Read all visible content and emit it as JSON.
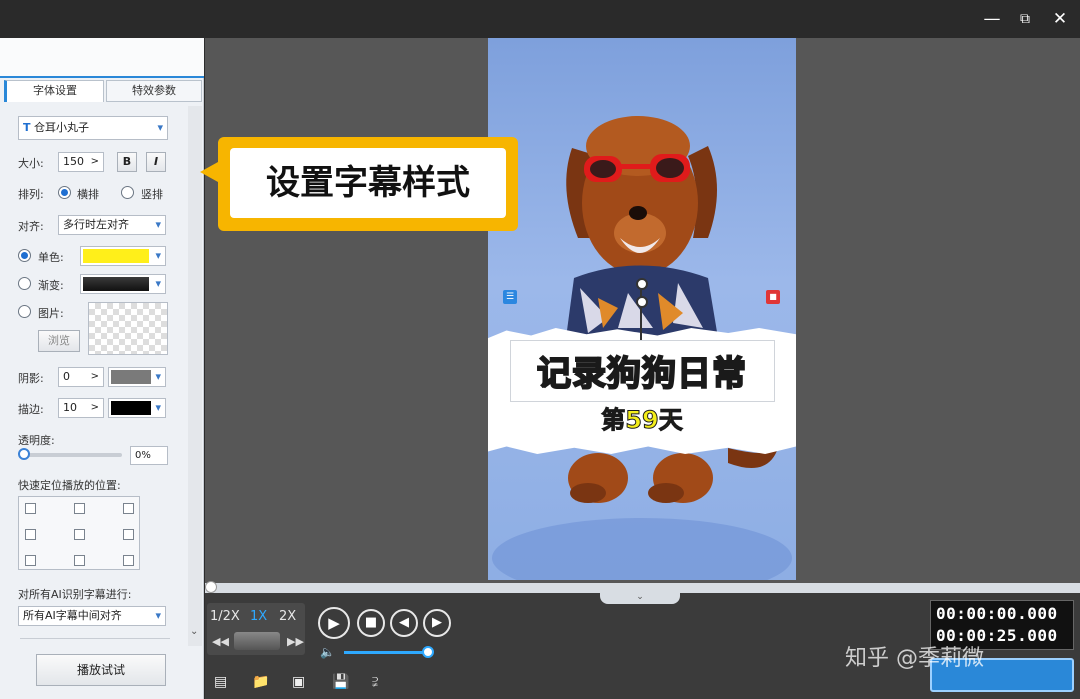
{
  "window": {
    "minimize_icon": "minimize-icon",
    "restore_icon": "restore-icon",
    "close_icon": "close-icon"
  },
  "tabs": [
    "字体设置",
    "特效参数"
  ],
  "font": {
    "name_prefix": "T",
    "name": "仓耳小丸子"
  },
  "size": {
    "label": "大小:",
    "value": "150",
    "bold": "B",
    "italic": "I"
  },
  "arrange": {
    "label": "排列:",
    "horizontal": "横排",
    "vertical": "竖排"
  },
  "align": {
    "label": "对齐:",
    "value": "多行时左对齐"
  },
  "color": {
    "solid_label": "单色:",
    "solid_value": "#ffef1a",
    "gradient_label": "渐变:",
    "image_label": "图片:",
    "browse": "浏览"
  },
  "shadow": {
    "label": "阴影:",
    "value": "0",
    "color": "#7a7a7a"
  },
  "stroke": {
    "label": "描边:",
    "value": "10",
    "color": "#000000"
  },
  "opacity": {
    "label": "透明度:",
    "value": "0%"
  },
  "position": {
    "label": "快速定位播放的位置:"
  },
  "ai": {
    "label": "对所有AI识别字幕进行:",
    "value": "所有AI字幕中间对齐"
  },
  "play_test": "播放试试",
  "callout": "设置字幕样式",
  "caption": {
    "title": "记录狗狗日常",
    "subtitle": "第59天"
  },
  "speeds": [
    "1/2X",
    "1X",
    "2X"
  ],
  "time": {
    "current": "00:00:00.000",
    "total": "00:00:25.000"
  },
  "watermark": "知乎 @季莉微",
  "colors": {
    "accent": "#f7b500",
    "caption_text": "#f4ee1a"
  }
}
